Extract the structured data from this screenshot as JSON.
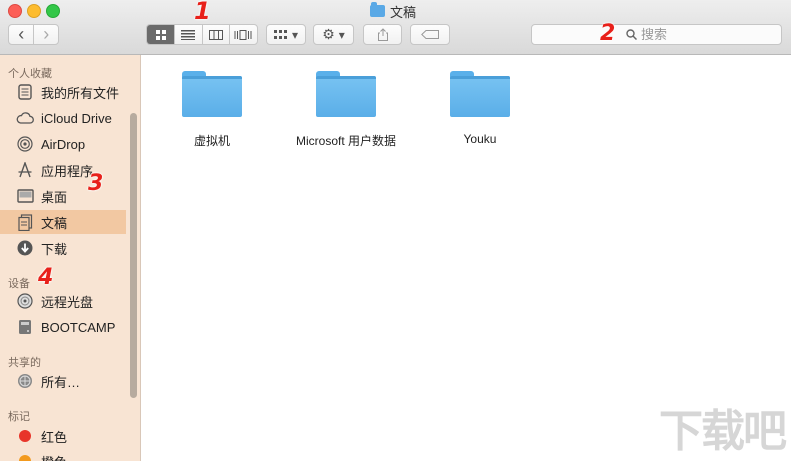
{
  "window": {
    "title": "文稿"
  },
  "toolbar": {
    "back_label": "‹",
    "forward_label": "›",
    "view_modes": [
      "icon",
      "list",
      "column",
      "cover-flow"
    ],
    "active_view": "icon",
    "arrange_label": "▾",
    "action_label": "▾",
    "search_placeholder": "搜索"
  },
  "annotations": {
    "badge1": "1",
    "badge2": "2",
    "badge3": "3",
    "badge4": "4"
  },
  "sidebar": {
    "favorites_header": "个人收藏",
    "favorites": [
      {
        "label": "我的所有文件",
        "icon": "all-files-icon"
      },
      {
        "label": "iCloud Drive",
        "icon": "cloud-icon"
      },
      {
        "label": "AirDrop",
        "icon": "airdrop-icon"
      },
      {
        "label": "应用程序",
        "icon": "applications-icon"
      },
      {
        "label": "桌面",
        "icon": "desktop-icon"
      },
      {
        "label": "文稿",
        "icon": "documents-icon",
        "selected": true
      },
      {
        "label": "下载",
        "icon": "download-icon"
      }
    ],
    "devices_header": "设备",
    "devices": [
      {
        "label": "远程光盘",
        "icon": "disc-icon"
      },
      {
        "label": "BOOTCAMP",
        "icon": "drive-icon"
      }
    ],
    "shared_header": "共享的",
    "shared": [
      {
        "label": "所有…",
        "icon": "network-icon"
      }
    ],
    "tags_header": "标记",
    "tags": [
      {
        "label": "红色",
        "color": "#e8352a"
      },
      {
        "label": "橙色",
        "color": "#f39a1e"
      }
    ]
  },
  "files": [
    {
      "name": "虚拟机"
    },
    {
      "name": "Microsoft 用户数据"
    },
    {
      "name": "Youku"
    }
  ],
  "watermark": "下载吧"
}
